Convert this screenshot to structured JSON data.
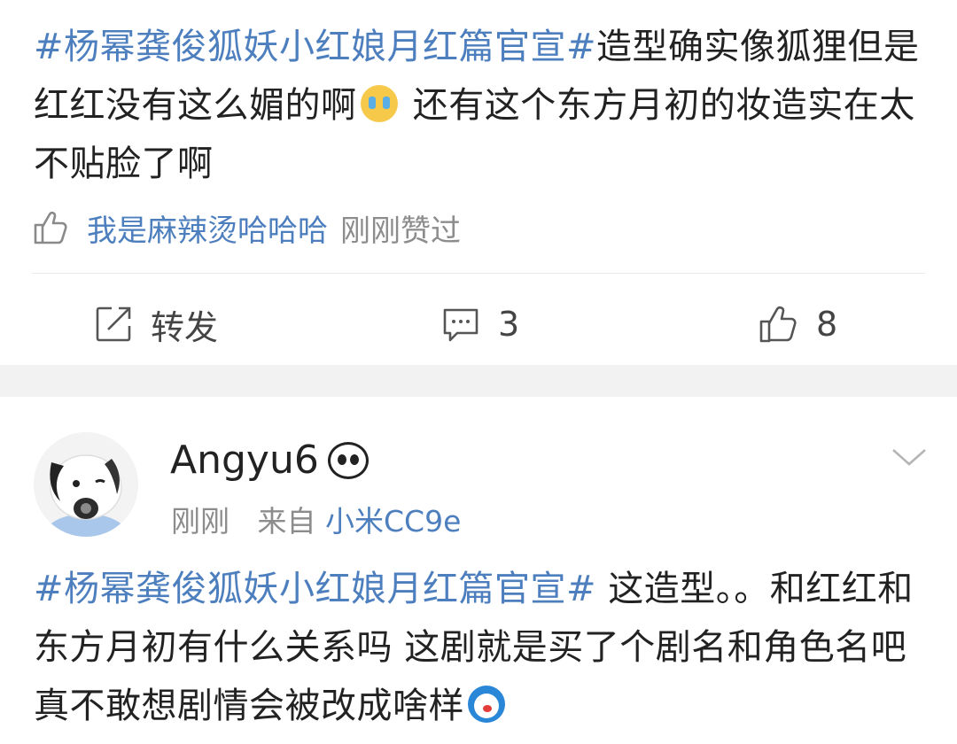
{
  "post1": {
    "topic": "#杨幂龚俊狐妖小红娘月红篇官宣#",
    "text_a": "造型确实像狐狸但是红红没有这么媚的啊",
    "emoji_a": "crying-face-icon",
    "text_b": " 还有这个东方月初的妆造实在太不贴脸了啊",
    "liker": "我是麻辣烫哈哈哈",
    "liked_when": "刚刚赞过",
    "repost_label": "转发",
    "comment_count": "3",
    "like_count": "8"
  },
  "post2": {
    "username": "Angyu6",
    "badge_icon": "panda-icon",
    "time": "刚刚",
    "source_prefix": "来自",
    "device": "小米CC9e",
    "topic": "#杨幂龚俊狐妖小红娘月红篇官宣#",
    "text": " 这造型。。和红红和东方月初有什么关系吗 这剧就是买了个剧名和角色名吧 真不敢想剧情会被改成啥样",
    "emoji": "doraemon-icon"
  },
  "colors": {
    "link": "#4d7fbf",
    "text": "#222222",
    "muted": "#8c8c8c",
    "separator": "#f2f2f2"
  }
}
